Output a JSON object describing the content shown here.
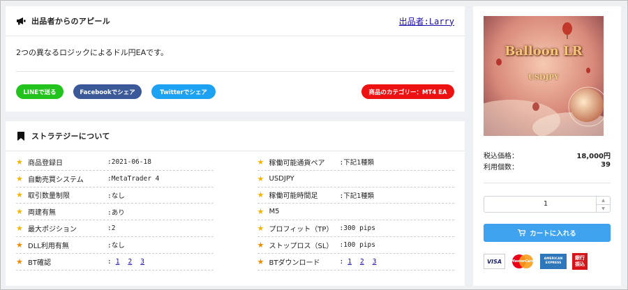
{
  "appeal": {
    "title": "出品者からのアピール",
    "seller_link": "出品者:Larry",
    "description": "2つの異なるロジックによるドル円EAです。",
    "share_line": "LINEで送る",
    "share_facebook": "Facebookでシェア",
    "share_twitter": "Twitterでシェア",
    "category_badge": "商品のカテゴリー：MT4 EA"
  },
  "strategy": {
    "title": "ストラテジーについて",
    "left": [
      {
        "label": "商品登録日",
        "value": ":2021-06-18",
        "star_color": "#f5b400"
      },
      {
        "label": "自動売買システム",
        "value": ":MetaTrader 4",
        "star_color": "#f5b400"
      },
      {
        "label": "取引数量制限",
        "value": ":なし",
        "star_color": "#f5b400"
      },
      {
        "label": "両建有無",
        "value": ":あり",
        "star_color": "#f5b400"
      },
      {
        "label": "最大ポジション",
        "value": ":2",
        "star_color": "#f5b400"
      },
      {
        "label": "DLL利用有無",
        "value": ":なし",
        "star_color": "#f08a00"
      },
      {
        "label": "BT確認",
        "value": ":",
        "links": [
          "1",
          "2",
          "3"
        ],
        "star_color": "#f08a00"
      }
    ],
    "right": [
      {
        "label": "稼働可能通貨ペア",
        "value": ":下記1種類",
        "star_color": "#f5b400"
      },
      {
        "label": "USDJPY",
        "value": "",
        "star_color": "#f5b400"
      },
      {
        "label": "稼働可能時間足",
        "value": ":下記1種類",
        "star_color": "#f5b400"
      },
      {
        "label": "M5",
        "value": "",
        "star_color": "#f5b400"
      },
      {
        "label": "プロフィット（TP）",
        "value": ":300 pips",
        "star_color": "#f5b400"
      },
      {
        "label": "ストップロス（SL）",
        "value": ":100 pips",
        "star_color": "#f08a00"
      },
      {
        "label": "BTダウンロード",
        "value": ":",
        "links": [
          "1",
          "2",
          "3"
        ],
        "star_color": "#f08a00"
      }
    ]
  },
  "product": {
    "image_title": "Balloon LR",
    "image_subtitle": "USDJPY",
    "price_label": "税込価格：",
    "price_value": "18,000円",
    "users_label": "利用個数：",
    "users_value": "39",
    "quantity": "1",
    "cart_button": "カートに入れる",
    "payments": [
      "VISA",
      "MasterCard",
      "AMERICAN EXPRESS",
      "銀行振込"
    ]
  },
  "colors": {
    "line": "#22c31c",
    "facebook": "#3b5998",
    "twitter": "#1da1f2",
    "category": "#ee1111",
    "cart": "#3fa2ee",
    "link": "#1a0dab"
  },
  "icons": {
    "appeal": "megaphone-icon",
    "strategy": "bookmark-icon",
    "star": "star-icon",
    "cart": "cart-icon"
  }
}
